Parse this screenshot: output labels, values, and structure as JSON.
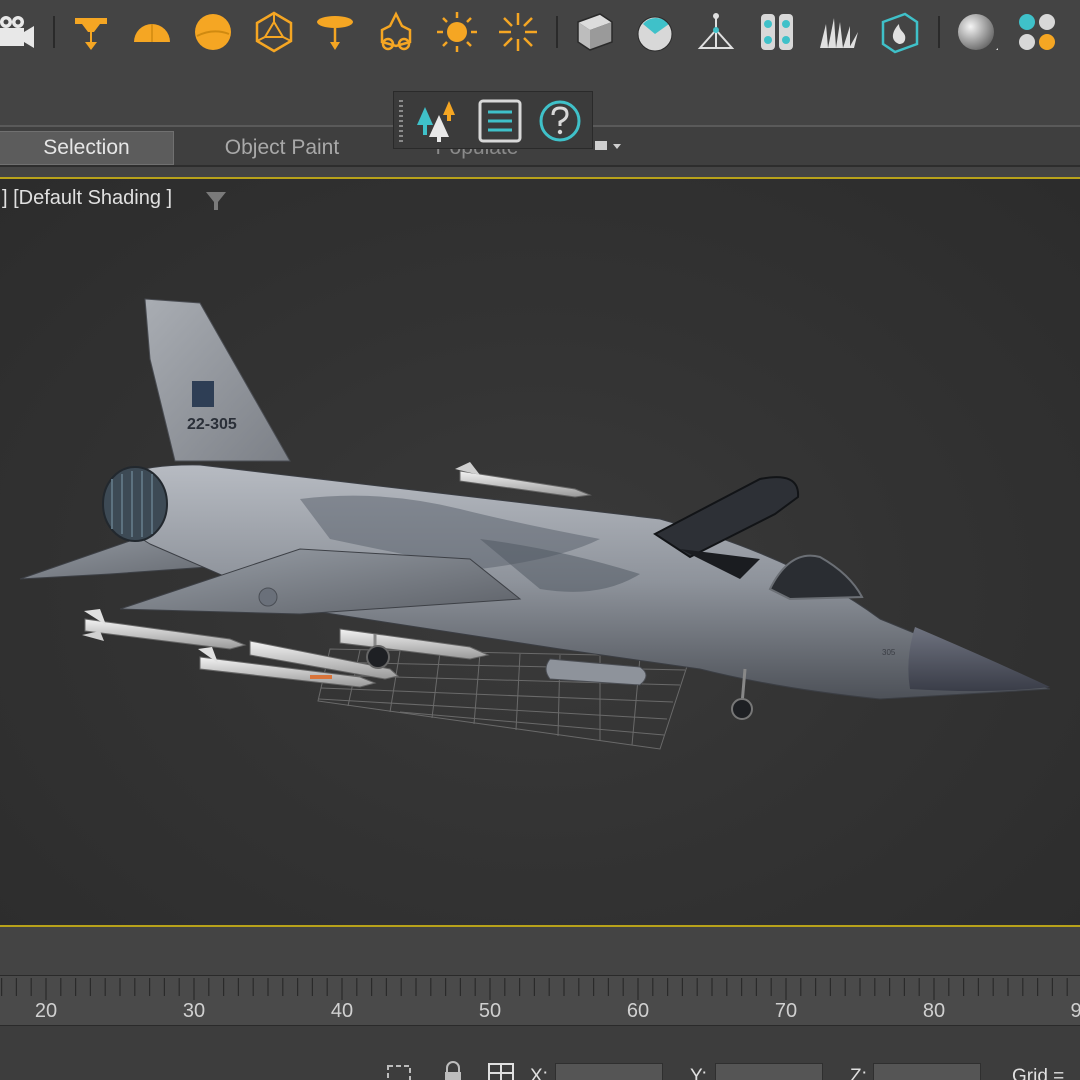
{
  "colors": {
    "icon_orange": "#f5a623",
    "accent_yellow": "#b8a21a",
    "teal": "#3fc1c9",
    "viewport_bg": "#333333"
  },
  "toolbar": {
    "icons": [
      "camera-icon",
      "target-spot-icon",
      "omni-half-dome-icon",
      "skylight-sphere-icon",
      "geosphere-light-icon",
      "spot-light-icon",
      "photometric-bulb-icon",
      "sun-icon",
      "daylight-burst-icon",
      "box-icon",
      "material-sphere-icon",
      "scatter-tripod-icon",
      "particle-cells-icon",
      "grass-icon",
      "fire-box-icon",
      "standard-sphere-icon",
      "multi-material-icon"
    ]
  },
  "tabs": {
    "selection": "Selection",
    "object_paint": "Object Paint",
    "populate": "Populate"
  },
  "populate_panel": {
    "icons": [
      "trees-icon",
      "list-icon",
      "help-icon"
    ]
  },
  "viewport": {
    "label": "] [Default Shading ]",
    "model": {
      "tail_number": "22-305",
      "nose_number": "305"
    }
  },
  "timeline": {
    "ticks": [
      "20",
      "30",
      "40",
      "50",
      "60",
      "70",
      "80",
      "9"
    ]
  },
  "statusbar": {
    "x_label": "X:",
    "y_label": "Y:",
    "z_label": "Z:",
    "grid_label": "Grid ="
  }
}
